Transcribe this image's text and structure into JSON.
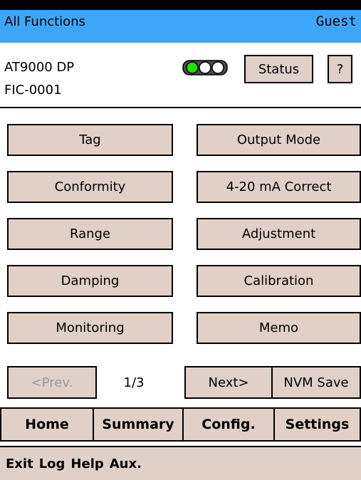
{
  "header": {
    "title": "All Functions",
    "user": "Guest"
  },
  "device": {
    "model": "AT9000 DP",
    "tag": "FIC-0001",
    "status_led": "communication-indicator-icon",
    "status_button": "Status",
    "help_button": "?"
  },
  "functions": {
    "tag": "Tag",
    "output_mode": "Output Mode",
    "conformity": "Conformity",
    "ma_correct": "4-20 mA Correct",
    "range": "Range",
    "adjustment": "Adjustment",
    "damping": "Damping",
    "calibration": "Calibration",
    "monitoring": "Monitoring",
    "memo": "Memo"
  },
  "pager": {
    "prev": "<Prev.",
    "page": "1/3",
    "next": "Next>",
    "nvm_save": "NVM Save"
  },
  "tabs": {
    "home": "Home",
    "summary": "Summary",
    "config": "Config.",
    "settings": "Settings"
  },
  "menu": {
    "exit": "Exit",
    "log": "Log",
    "help": "Help",
    "aux": "Aux."
  },
  "colors": {
    "titlebar": "#3ea6f8",
    "button": "#e0d0c8",
    "led_on": "#22e000"
  }
}
